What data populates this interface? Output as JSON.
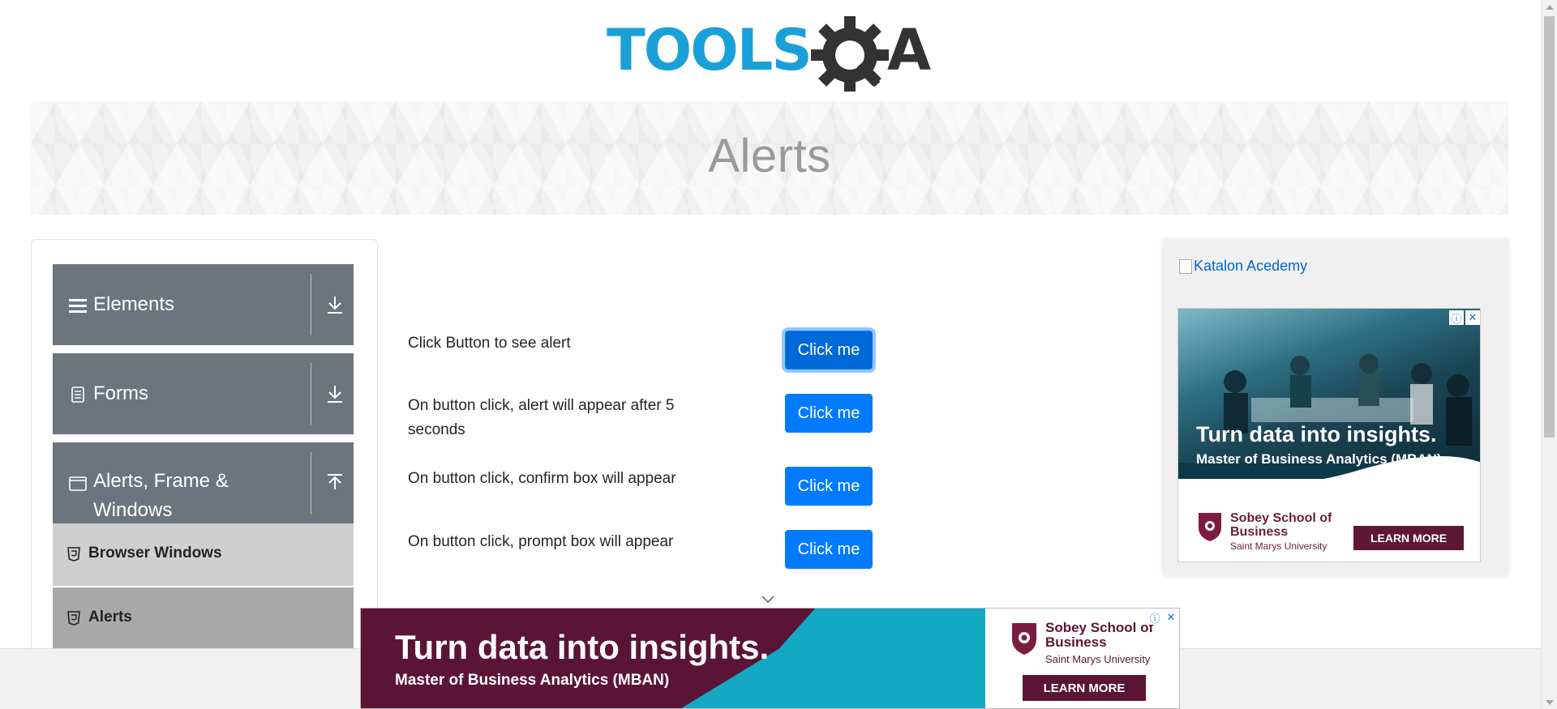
{
  "header": {
    "logo_text": "TOOLSQA"
  },
  "banner": {
    "title": "Alerts"
  },
  "sidebar": {
    "groups": [
      {
        "label": "Elements",
        "icon": "hamburger-icon",
        "arrow": "download-arrow-icon"
      },
      {
        "label": "Forms",
        "icon": "form-icon",
        "arrow": "download-arrow-icon"
      },
      {
        "label": "Alerts, Frame & Windows",
        "icon": "window-icon",
        "arrow": "upload-arrow-icon"
      }
    ],
    "sub_items": [
      {
        "label": "Browser Windows",
        "icon": "html5-icon",
        "active": false
      },
      {
        "label": "Alerts",
        "icon": "html5-icon",
        "active": true
      }
    ],
    "colors": {
      "group_bg": "#6c757d",
      "sub_bg": "#cfcfcf",
      "sub_active_bg": "#a9a9a9"
    }
  },
  "main": {
    "rows": [
      {
        "label": "Click Button to see alert",
        "button": "Click me"
      },
      {
        "label": "On button click, alert will appear after 5 seconds",
        "button": "Click me"
      },
      {
        "label": "On button click, confirm box will appear",
        "button": "Click me"
      },
      {
        "label": "On button click, prompt box will appear",
        "button": "Click me"
      }
    ],
    "colors": {
      "button": "#007bff"
    }
  },
  "right_ad": {
    "link_text": "Katalon Acedemy",
    "headline": "Turn data into insights.",
    "subline": "Master of Business Analytics (MBAN)",
    "school": "Sobey School of Business",
    "university": "Saint Marys University",
    "cta": "LEARN MORE",
    "close_icon": "close-icon",
    "info_icon": "info-icon"
  },
  "bottom_ad": {
    "headline": "Turn data into insights.",
    "subline": "Master of Business Analytics (MBAN)",
    "school": "Sobey School of Business",
    "university": "Saint Marys University",
    "cta": "LEARN MORE"
  }
}
